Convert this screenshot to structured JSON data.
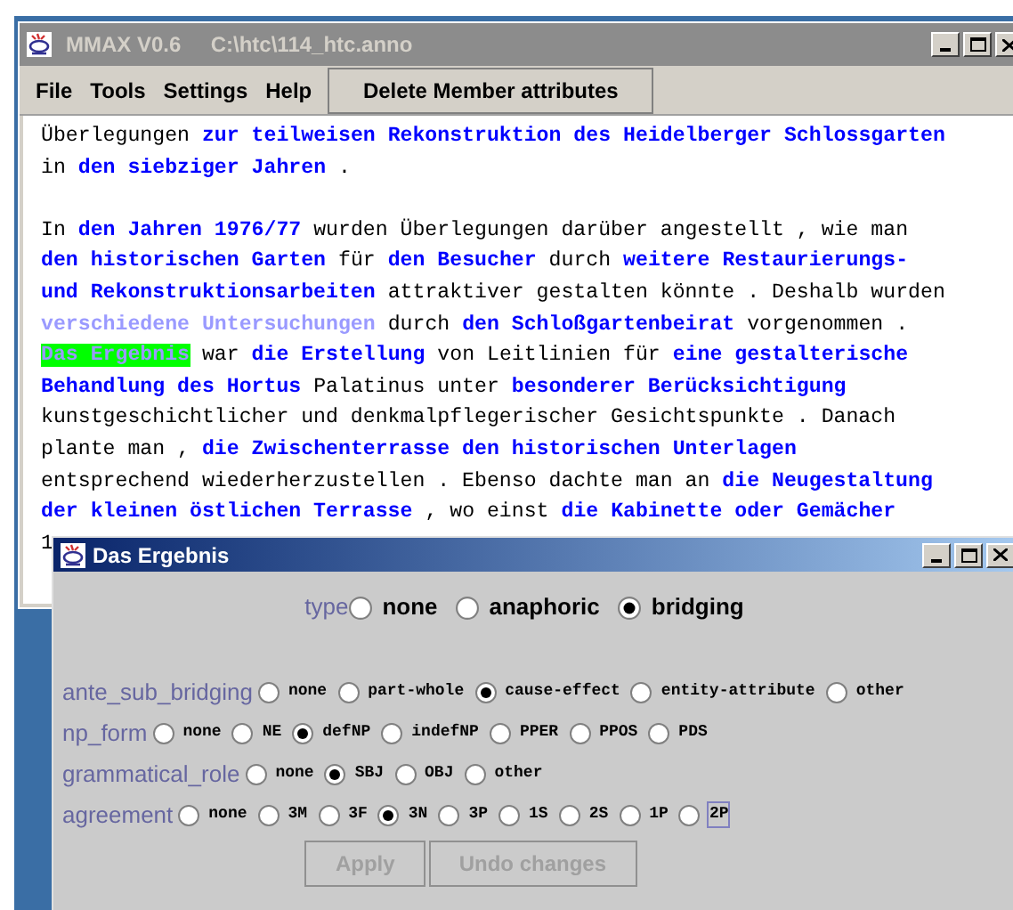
{
  "main_window": {
    "title": "MMAX V0.6     C:\\htc\\114_htc.anno",
    "active": false
  },
  "menu": [
    "File",
    "Tools",
    "Settings",
    "Help"
  ],
  "toolbar_button": {
    "label": "Delete Member attributes"
  },
  "paragraphs": [
    [
      [
        {
          "text": "Überlegungen ",
          "kind": "plain"
        },
        {
          "text": "zur teilweisen Rekonstruktion des Heidelberger Schlossgarten",
          "kind": "markable"
        }
      ],
      [
        {
          "text": "in ",
          "kind": "plain"
        },
        {
          "text": "den siebziger Jahren",
          "kind": "markable"
        },
        {
          "text": " .",
          "kind": "plain"
        }
      ]
    ],
    [
      [
        {
          "text": "In ",
          "kind": "plain"
        },
        {
          "text": "den Jahren 1976/77",
          "kind": "markable"
        },
        {
          "text": " wurden Überlegungen darüber angestellt , wie man",
          "kind": "plain"
        }
      ],
      [
        {
          "text": "den historischen Garten",
          "kind": "markable"
        },
        {
          "text": " für ",
          "kind": "plain"
        },
        {
          "text": "den Besucher",
          "kind": "markable"
        },
        {
          "text": " durch ",
          "kind": "plain"
        },
        {
          "text": "weitere Restaurierungs-",
          "kind": "markable"
        }
      ],
      [
        {
          "text": "und Rekonstruktionsarbeiten",
          "kind": "markable"
        },
        {
          "text": " attraktiver gestalten könnte . Deshalb wurden",
          "kind": "plain"
        }
      ],
      [
        {
          "text": "verschiedene Untersuchungen",
          "kind": "muted"
        },
        {
          "text": " durch ",
          "kind": "plain"
        },
        {
          "text": "den Schloßgartenbeirat",
          "kind": "markable"
        },
        {
          "text": " vorgenommen .",
          "kind": "plain"
        }
      ],
      [
        {
          "text": "Das Ergebnis",
          "kind": "highlight"
        },
        {
          "text": " war ",
          "kind": "plain"
        },
        {
          "text": "die Erstellung",
          "kind": "markable"
        },
        {
          "text": " von Leitlinien für ",
          "kind": "plain"
        },
        {
          "text": "eine gestalterische",
          "kind": "markable"
        }
      ],
      [
        {
          "text": "Behandlung des Hortus",
          "kind": "markable"
        },
        {
          "text": " Palatinus unter ",
          "kind": "plain"
        },
        {
          "text": "besonderer Berücksichtigung",
          "kind": "markable"
        }
      ],
      [
        {
          "text": "kunstgeschichtlicher und denkmalpflegerischer Gesichtspunkte . Danach",
          "kind": "plain"
        }
      ],
      [
        {
          "text": "plante man , ",
          "kind": "plain"
        },
        {
          "text": "die Zwischenterrasse den historischen Unterlagen",
          "kind": "markable"
        }
      ],
      [
        {
          "text": "entsprechend wiederherzustellen . Ebenso dachte man an ",
          "kind": "plain"
        },
        {
          "text": "die Neugestaltung",
          "kind": "markable"
        }
      ],
      [
        {
          "text": "der kleinen östlichen Terrasse",
          "kind": "markable"
        },
        {
          "text": " , wo einst ",
          "kind": "plain"
        },
        {
          "text": "die Kabinette oder Gemächer",
          "kind": "markable"
        }
      ],
      [
        {
          "text": "1",
          "kind": "plain"
        }
      ]
    ]
  ],
  "dialog": {
    "title": "Das Ergebnis",
    "active": true,
    "attributes": [
      {
        "name": "type",
        "kind": "main",
        "options": [
          {
            "label": "none",
            "selected": false,
            "focused": false
          },
          {
            "label": "anaphoric",
            "selected": false,
            "focused": false
          },
          {
            "label": "bridging",
            "selected": true,
            "focused": false
          }
        ]
      },
      {
        "name": "ante_sub_bridging",
        "kind": "sub",
        "options": [
          {
            "label": "none",
            "selected": false,
            "focused": false
          },
          {
            "label": "part-whole",
            "selected": false,
            "focused": false
          },
          {
            "label": "cause-effect",
            "selected": true,
            "focused": false
          },
          {
            "label": "entity-attribute",
            "selected": false,
            "focused": false
          },
          {
            "label": "other",
            "selected": false,
            "focused": false
          }
        ]
      },
      {
        "name": "np_form",
        "kind": "sub",
        "options": [
          {
            "label": "none",
            "selected": false,
            "focused": false
          },
          {
            "label": "NE",
            "selected": false,
            "focused": false
          },
          {
            "label": "defNP",
            "selected": true,
            "focused": false
          },
          {
            "label": "indefNP",
            "selected": false,
            "focused": false
          },
          {
            "label": "PPER",
            "selected": false,
            "focused": false
          },
          {
            "label": "PPOS",
            "selected": false,
            "focused": false
          },
          {
            "label": "PDS",
            "selected": false,
            "focused": false
          }
        ]
      },
      {
        "name": "grammatical_role",
        "kind": "sub",
        "options": [
          {
            "label": "none",
            "selected": false,
            "focused": false
          },
          {
            "label": "SBJ",
            "selected": true,
            "focused": false
          },
          {
            "label": "OBJ",
            "selected": false,
            "focused": false
          },
          {
            "label": "other",
            "selected": false,
            "focused": false
          }
        ]
      },
      {
        "name": "agreement",
        "kind": "sub",
        "options": [
          {
            "label": "none",
            "selected": false,
            "focused": false
          },
          {
            "label": "3M",
            "selected": false,
            "focused": false
          },
          {
            "label": "3F",
            "selected": false,
            "focused": false
          },
          {
            "label": "3N",
            "selected": true,
            "focused": false
          },
          {
            "label": "3P",
            "selected": false,
            "focused": false
          },
          {
            "label": "1S",
            "selected": false,
            "focused": false
          },
          {
            "label": "2S",
            "selected": false,
            "focused": false
          },
          {
            "label": "1P",
            "selected": false,
            "focused": false
          },
          {
            "label": "2P",
            "selected": false,
            "focused": true
          }
        ]
      }
    ],
    "buttons": [
      {
        "label": "Apply",
        "disabled": true
      },
      {
        "label": "Undo changes",
        "disabled": true
      }
    ]
  }
}
